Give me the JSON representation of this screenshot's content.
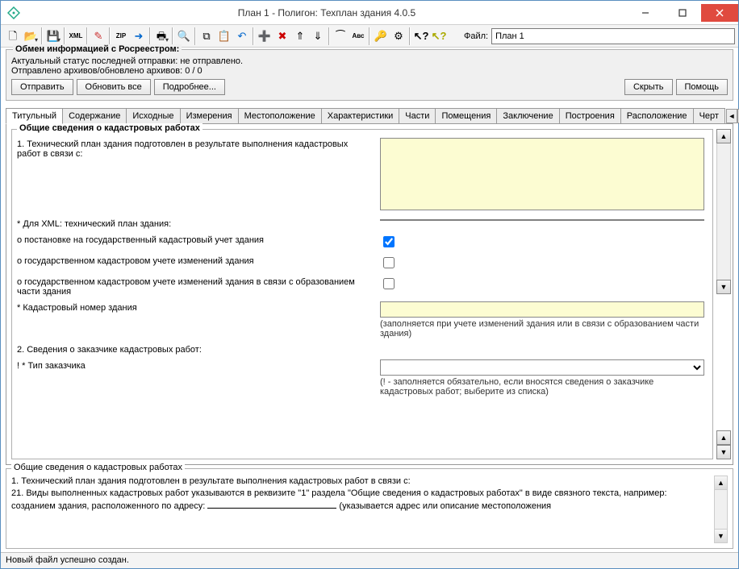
{
  "window": {
    "title": "План 1 - Полигон: Техплан здания 4.0.5"
  },
  "toolbar": {
    "file_label": "Файл:",
    "file_value": "План 1",
    "buttons": [
      {
        "name": "new-icon",
        "title": "Новый"
      },
      {
        "name": "open-icon",
        "title": "Открыть"
      },
      {
        "name": "save-icon",
        "title": "Сохранить"
      },
      {
        "name": "xml-icon",
        "title": "XML"
      },
      {
        "name": "sign-icon",
        "title": "Подпись"
      },
      {
        "name": "zip-icon",
        "title": "ZIP"
      },
      {
        "name": "send-icon",
        "title": "Отправить"
      },
      {
        "name": "print-icon",
        "title": "Печать"
      },
      {
        "name": "preview-icon",
        "title": "Просмотр"
      },
      {
        "name": "copy-icon",
        "title": "Копировать"
      },
      {
        "name": "paste-icon",
        "title": "Вставить"
      },
      {
        "name": "undo-icon",
        "title": "Отменить"
      },
      {
        "name": "row-add-icon",
        "title": "Добавить строку"
      },
      {
        "name": "row-del-icon",
        "title": "Удалить строку"
      },
      {
        "name": "row-up-icon",
        "title": "Вверх"
      },
      {
        "name": "row-down-icon",
        "title": "Вниз"
      },
      {
        "name": "wand-icon",
        "title": "Инструмент"
      },
      {
        "name": "abc-icon",
        "title": "Abc"
      },
      {
        "name": "search-icon",
        "title": "Поиск"
      },
      {
        "name": "filter-icon",
        "title": "Фильтр"
      },
      {
        "name": "help-context-icon",
        "title": "?"
      },
      {
        "name": "help-cursor-icon",
        "title": "?"
      }
    ]
  },
  "rosreestr": {
    "legend": "Обмен информацией с Росреестром:",
    "line1": "Актуальный статус последней отправки: не отправлено.",
    "line2": "Отправлено архивов/обновлено архивов: 0 / 0",
    "btn_send": "Отправить",
    "btn_refresh": "Обновить все",
    "btn_more": "Подробнее...",
    "btn_hide": "Скрыть",
    "btn_help": "Помощь"
  },
  "tabs": {
    "items": [
      "Титульный",
      "Содержание",
      "Исходные",
      "Измерения",
      "Местоположение",
      "Характеристики",
      "Части",
      "Помещения",
      "Заключение",
      "Построения",
      "Расположение",
      "Черт"
    ],
    "active_index": 0
  },
  "form": {
    "group_title": "Общие сведения о кадастровых работах",
    "r1_label": "1. Технический план здания подготовлен в результате выполнения кадастровых работ в связи с:",
    "r1_value": "",
    "xml_label": "* Для XML: технический план здания:",
    "chk1_label": "о постановке на государственный кадастровый учет здания",
    "chk1_checked": true,
    "chk2_label": "о государственном кадастровом учете изменений здания",
    "chk2_checked": false,
    "chk3_label": "о государственном кадастровом учете изменений здания в связи с образованием части здания",
    "chk3_checked": false,
    "kadnum_label": "* Кадастровый номер здания",
    "kadnum_value": "",
    "kadnum_hint": "(заполняется при учете изменений здания или в связи с образованием части здания)",
    "r2_label": "2. Сведения о заказчике кадастровых работ:",
    "cust_type_label": "! * Тип заказчика",
    "cust_type_value": "",
    "cust_type_hint": "(! - заполняется обязательно, если вносятся сведения о заказчике кадастровых работ; выберите из списка)"
  },
  "help": {
    "legend": "Общие сведения о кадастровых работах",
    "line1": "1. Технический план здания подготовлен в результате выполнения кадастровых работ в связи с:",
    "line2_prefix": "    21. Виды выполненных кадастровых работ указываются в реквизите \"1\" раздела \"Общие сведения о кадастровых работах\" в виде связного текста, например:",
    "line3_prefix": "    созданием здания, расположенного по адресу: ",
    "line3_suffix": " (указывается адрес или описание местоположения"
  },
  "statusbar": {
    "text": "Новый файл успешно создан."
  }
}
